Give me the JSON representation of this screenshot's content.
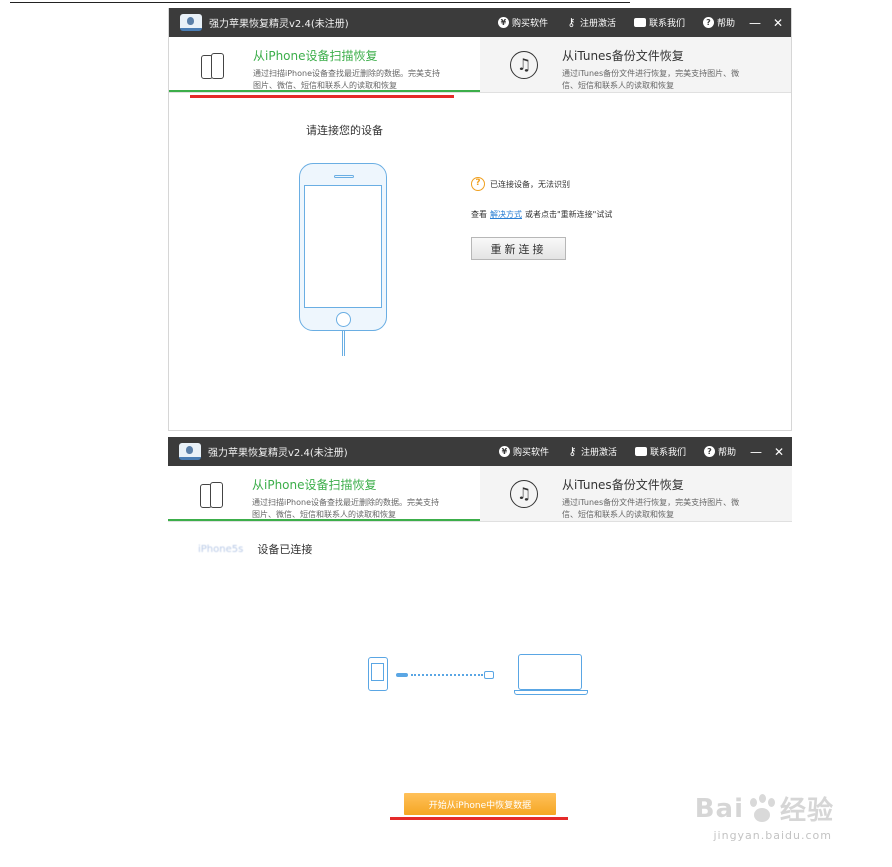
{
  "app": {
    "title": "强力苹果恢复精灵v2.4(未注册)",
    "menu": [
      {
        "label": "购买软件",
        "icon": "currency-icon"
      },
      {
        "label": "注册激活",
        "icon": "key-icon"
      },
      {
        "label": "联系我们",
        "icon": "chat-icon"
      },
      {
        "label": "帮助",
        "icon": "help-icon"
      }
    ],
    "minimize": "—",
    "close": "✕"
  },
  "tabs": [
    {
      "title": "从iPhone设备扫描恢复",
      "desc": "通过扫描iPhone设备查找最近删除的数据。完美支持图片、微信、短信和联系人的读取和恢复",
      "active": true
    },
    {
      "title": "从iTunes备份文件恢复",
      "desc": "通过iTunes备份文件进行恢复，完美支持图片、微信、短信和联系人的读取和恢复",
      "active": false
    }
  ],
  "screen1": {
    "connect_title": "请连接您的设备",
    "warning": "已连接设备，无法识别",
    "hint_prefix": "查看",
    "hint_link": "解决方式",
    "hint_suffix": "或者点击\"重新连接\"试试",
    "reconnect_button": "重新连接"
  },
  "screen2": {
    "device_name": "iPhone5s",
    "device_status": "设备已连接",
    "start_button": "开始从iPhone中恢复数据"
  },
  "watermark": {
    "brand_left": "Bai",
    "brand_right": "经验",
    "url": "jingyan.baidu.com"
  },
  "colors": {
    "accent_green": "#3cae4a",
    "titlebar": "#3b3b3b",
    "link_blue": "#2a7fd4",
    "warning_orange": "#f0a020",
    "start_button": "#f5a623",
    "underline_red": "#e52a2a"
  }
}
